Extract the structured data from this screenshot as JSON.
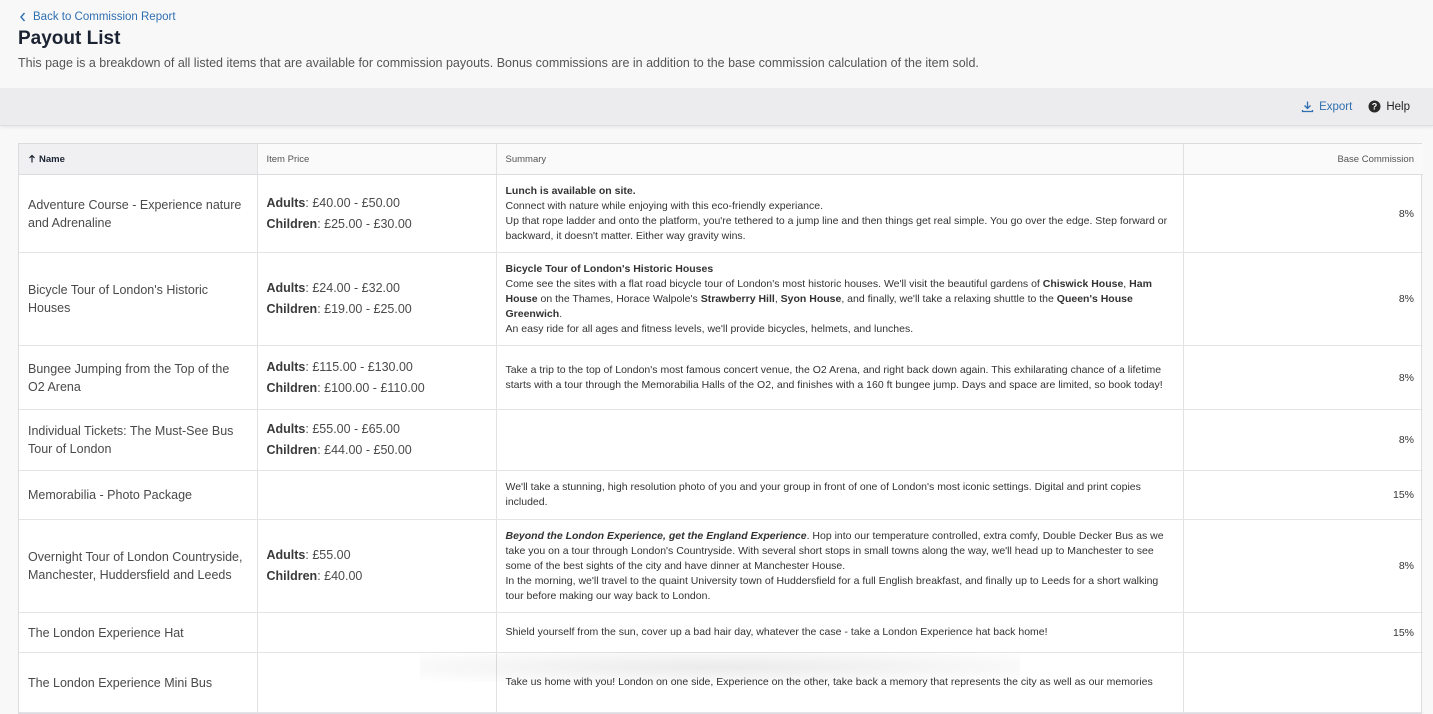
{
  "nav": {
    "back_label": "Back to Commission Report"
  },
  "page": {
    "title": "Payout List",
    "description": "This page is a breakdown of all listed items that are available for commission payouts. Bonus commissions are in addition to the base commission calculation of the item sold."
  },
  "toolbar": {
    "export_label": "Export",
    "help_label": "Help"
  },
  "table": {
    "columns": {
      "name": "Name",
      "price": "Item Price",
      "summary": "Summary",
      "commission": "Base Commission"
    },
    "sort": {
      "column": "Name",
      "direction": "ascending"
    },
    "rows": [
      {
        "name": "Adventure Course - Experience nature and Adrenaline",
        "prices": [
          {
            "label": "Adults",
            "value": ": £40.00 - £50.00"
          },
          {
            "label": "Children",
            "value": ": £25.00 - £30.00"
          }
        ],
        "summary": [
          [
            {
              "t": "Lunch is available on site.",
              "b": true
            }
          ],
          [
            {
              "t": "Connect with nature while enjoying with this eco-friendly experiance."
            }
          ],
          [
            {
              "t": "Up that rope ladder and onto the platform, you're tethered to a jump line and then things get real simple. You go over the edge. Step forward or backward, it doesn't matter. Either way gravity wins."
            }
          ]
        ],
        "commission": "8%"
      },
      {
        "name": "Bicycle Tour of London's Historic Houses",
        "prices": [
          {
            "label": "Adults",
            "value": ": £24.00 - £32.00"
          },
          {
            "label": "Children",
            "value": ": £19.00 - £25.00"
          }
        ],
        "summary": [
          [
            {
              "t": "Bicycle Tour of London's Historic Houses",
              "b": true
            }
          ],
          [
            {
              "t": "Come see the sites with a flat road bicycle tour of London's most historic houses. We'll visit the beautiful gardens of "
            },
            {
              "t": "Chiswick House",
              "b": true
            },
            {
              "t": ", "
            },
            {
              "t": "Ham House",
              "b": true
            },
            {
              "t": " on the Thames, Horace Walpole's "
            },
            {
              "t": "Strawberry Hill",
              "b": true
            },
            {
              "t": ", "
            },
            {
              "t": "Syon House",
              "b": true
            },
            {
              "t": ", and finally, we'll take a relaxing shuttle to the "
            },
            {
              "t": "Queen's House Greenwich",
              "b": true
            },
            {
              "t": "."
            }
          ],
          [
            {
              "t": "An easy ride for all ages and fitness levels, we'll provide bicycles, helmets, and lunches."
            }
          ]
        ],
        "commission": "8%"
      },
      {
        "name": "Bungee Jumping from the Top of the O2 Arena",
        "prices": [
          {
            "label": "Adults",
            "value": ": £115.00 - £130.00"
          },
          {
            "label": "Children",
            "value": ": £100.00 - £110.00"
          }
        ],
        "summary": [
          [
            {
              "t": "Take a trip to the top of London's most famous concert venue, the O2 Arena, and right back down again. This exhilarating chance of a lifetime starts with a tour through the Memorabilia Halls of the O2, and finishes with a 160 ft bungee jump. Days and space are limited, so book today!"
            }
          ]
        ],
        "commission": "8%"
      },
      {
        "name": "Individual Tickets: The Must-See Bus Tour of London",
        "prices": [
          {
            "label": "Adults",
            "value": ": £55.00 - £65.00"
          },
          {
            "label": "Children",
            "value": ": £44.00 - £50.00"
          }
        ],
        "summary": [],
        "commission": "8%"
      },
      {
        "name": "Memorabilia - Photo Package",
        "prices": [],
        "summary": [
          [
            {
              "t": "We'll take a stunning, high resolution photo of you and your group in front of one of London's most iconic settings. Digital and print copies included."
            }
          ]
        ],
        "commission": "15%"
      },
      {
        "name": "Overnight Tour of London Countryside, Manchester, Huddersfield and Leeds",
        "prices": [
          {
            "label": "Adults",
            "value": ": £55.00"
          },
          {
            "label": "Children",
            "value": ": £40.00"
          }
        ],
        "summary": [
          [
            {
              "t": "Beyond the London Experience, get the England Experience",
              "b": true,
              "i": true
            },
            {
              "t": ". Hop into our temperature controlled, extra comfy, Double Decker Bus as we take you on a tour through London's Countryside. With several short stops in small towns along the way, we'll head up to Manchester to see some of the best sights of the city and have dinner at Manchester House."
            }
          ],
          [
            {
              "t": "In the morning, we'll travel to the quaint University town of Huddersfield for a full English breakfast, and finally up to Leeds for a short walking tour before making our way back to London."
            }
          ]
        ],
        "commission": "8%"
      },
      {
        "name": "The London Experience Hat",
        "prices": [],
        "summary": [
          [
            {
              "t": "Shield yourself from the sun, cover up a bad hair day, whatever the case - take a London Experience hat back home!"
            }
          ]
        ],
        "commission": "15%"
      },
      {
        "name": "The London Experience Mini Bus",
        "prices": [],
        "summary": [
          [
            {
              "t": "Take us home with you! London on one side, Experience on the other, take back a memory that represents the city as well as our memories"
            }
          ]
        ],
        "commission": ""
      }
    ]
  }
}
